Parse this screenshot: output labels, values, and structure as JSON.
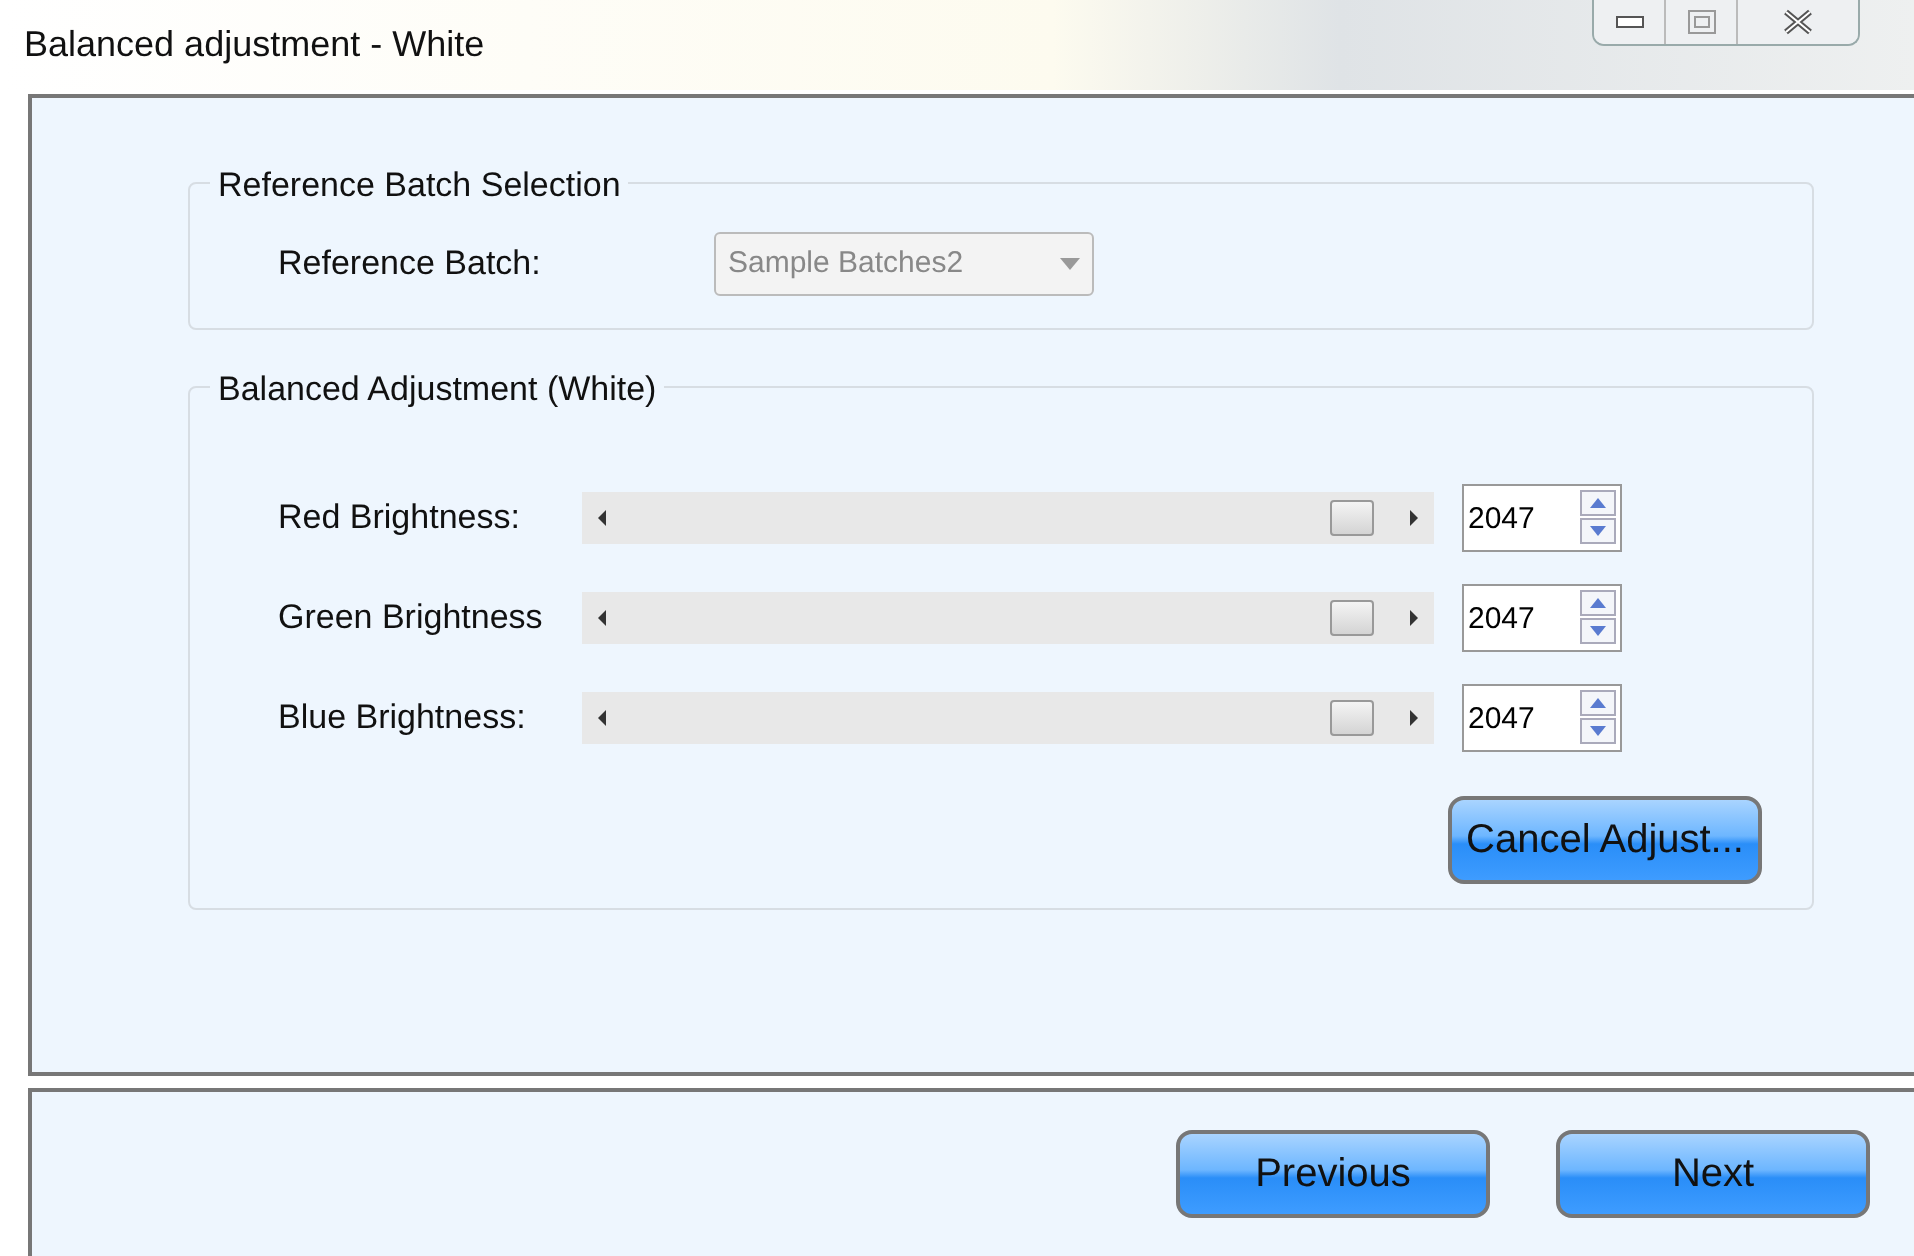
{
  "window": {
    "title": "Balanced adjustment - White"
  },
  "reference_group": {
    "title": "Reference Batch Selection",
    "label": "Reference Batch:",
    "dropdown": {
      "value": "Sample Batches2",
      "disabled": true
    }
  },
  "adjust_group": {
    "title": "Balanced Adjustment (White)",
    "sliders": [
      {
        "label": "Red Brightness:",
        "level": 0.95,
        "value": "2047"
      },
      {
        "label": "Green Brightness",
        "level": 0.95,
        "value": "2047"
      },
      {
        "label": "Blue Brightness:",
        "level": 0.95,
        "value": "2047"
      }
    ],
    "cancel_button": "Cancel Adjust..."
  },
  "buttons": [
    "Previous",
    "Next"
  ]
}
